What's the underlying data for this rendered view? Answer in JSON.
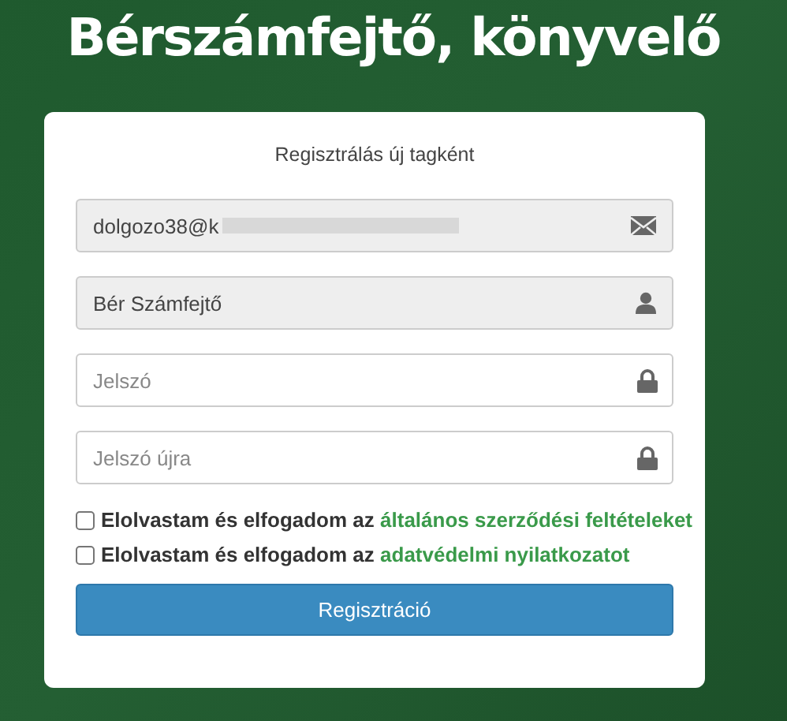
{
  "page_title": "Bérszámfejtő, könyvelő",
  "form": {
    "heading": "Regisztrálás új tagként",
    "fields": [
      {
        "kind": "email",
        "value": "dolgozo38@k",
        "redacted": true,
        "disabled": true
      },
      {
        "kind": "name",
        "value": "Bér Számfejtő",
        "redacted": false,
        "disabled": true
      },
      {
        "kind": "password",
        "placeholder": "Jelszó",
        "disabled": false
      },
      {
        "kind": "password",
        "placeholder": "Jelszó újra",
        "disabled": false
      }
    ],
    "agreements": [
      {
        "text": "Elolvastam és elfogadom az",
        "link": "általános szerződési feltételeket",
        "checked": false
      },
      {
        "text": "Elolvastam és elfogadom az",
        "link": "adatvédelmi nyilatkozatot",
        "checked": false
      }
    ],
    "submit": "Regisztráció"
  }
}
